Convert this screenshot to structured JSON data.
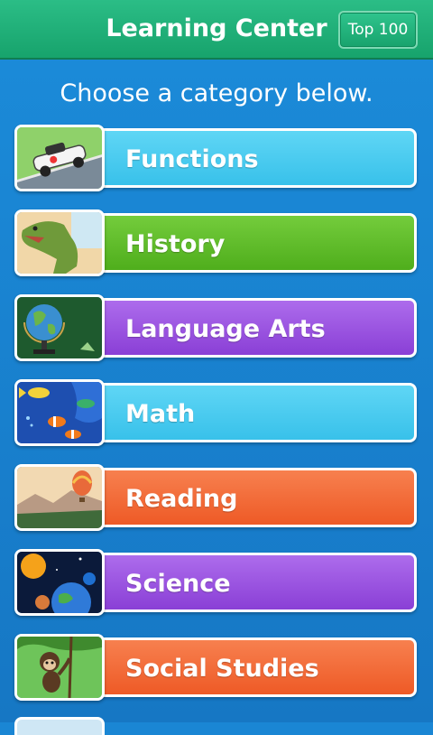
{
  "header": {
    "title": "Learning Center",
    "top_button": "Top 100"
  },
  "subtitle": "Choose a category below.",
  "categories": [
    {
      "label": "Functions",
      "color": "#49cdf0",
      "thumbnail_icon": "race-car-icon"
    },
    {
      "label": "History",
      "color": "#5ec02a",
      "thumbnail_icon": "dinosaur-icon"
    },
    {
      "label": "Language Arts",
      "color": "#9a4fe0",
      "thumbnail_icon": "globe-icon"
    },
    {
      "label": "Math",
      "color": "#49cdf0",
      "thumbnail_icon": "fish-icon"
    },
    {
      "label": "Reading",
      "color": "#f26533",
      "thumbnail_icon": "hot-air-balloon-icon"
    },
    {
      "label": "Science",
      "color": "#9a4fe0",
      "thumbnail_icon": "planets-icon"
    },
    {
      "label": "Social Studies",
      "color": "#f26533",
      "thumbnail_icon": "monkey-icon"
    }
  ]
}
